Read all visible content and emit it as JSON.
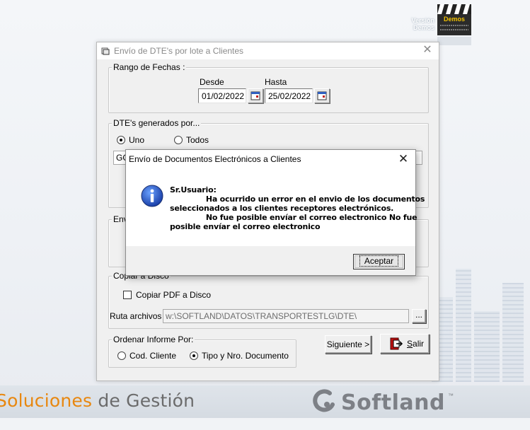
{
  "background": {
    "version_label": "Versión\nDemos",
    "clapper_label": "Demos",
    "brand_left_part1": "Soluciones",
    "brand_left_part2": "de Gestión",
    "brand_right": "Softland",
    "trademark": "™",
    "colors": {
      "accent_orange": "#e8870f",
      "brand_gray": "#7d8086"
    }
  },
  "main_window": {
    "title": "Envío de DTE's por lote a Clientes",
    "date_range": {
      "legend": "Rango de Fechas :",
      "from_label": "Desde",
      "from_value": "01/02/2022",
      "to_label": "Hasta",
      "to_value": "25/02/2022"
    },
    "generated_by": {
      "legend": "DTE's generados por...",
      "option_one": "Uno",
      "option_all": "Todos",
      "selected": "Uno",
      "combo_value_partial": "GG"
    },
    "send_group_partial_legend": "Env",
    "copy_group": {
      "legend": "Copiar a Disco",
      "checkbox_label": "Copiar PDF a Disco",
      "path_label": "Ruta archivos :",
      "path_value": "w:\\SOFTLAND\\DATOS\\TRANSPORTESTLG\\DTE\\",
      "browse_label": "..."
    },
    "order_group": {
      "legend": "Ordenar Informe Por:",
      "option_client": "Cod. Cliente",
      "option_type": "Tipo y Nro. Documento",
      "selected": "Tipo y Nro. Documento"
    },
    "next_button": "Siguiente >",
    "exit_button_first": "S",
    "exit_button_rest": "alir"
  },
  "dialog": {
    "title": "Envío de Documentos Electrónicos a Clientes",
    "message": "Sr.Usuario:\n              Ha ocurrido un error en el envio de los documentos\nseleccionados a los clientes receptores electrónicos.\n              No fue posible envíar el correo electronico No fue\nposible envíar el correo electronico",
    "ok_button": "Aceptar"
  }
}
